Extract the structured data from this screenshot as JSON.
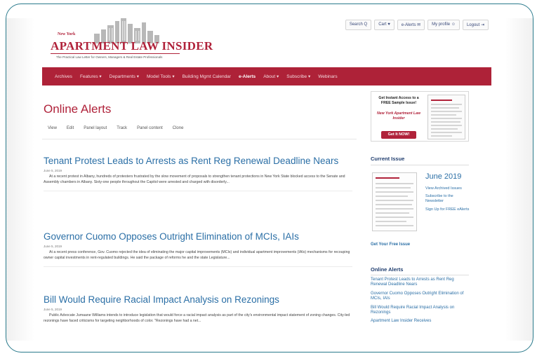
{
  "header": {
    "logo": {
      "newyork": "New York",
      "title": "Apartment Law Insider",
      "tagline": "The Practical Law Letter for Owners, Managers & Real Estate Professionals"
    },
    "toplinks": [
      {
        "label": "Search",
        "icon": "search-icon"
      },
      {
        "label": "Cart",
        "icon": "cart-icon"
      },
      {
        "label": "e-Alerts",
        "icon": "email-icon"
      },
      {
        "label": "My profile",
        "icon": "user-icon"
      },
      {
        "label": "Logout",
        "icon": "logout-icon"
      }
    ],
    "toplink_text": [
      "Search Q",
      "Cart ♥",
      "e-Alerts ✉",
      "My profile ☺",
      "Logout ⇥"
    ]
  },
  "nav": {
    "items": [
      "Archives",
      "Features ▾",
      "Departments ▾",
      "Model Tools ▾",
      "Building Mgmt Calendar",
      "e-Alerts",
      "About ▾",
      "Subscribe ▾",
      "Webinars"
    ],
    "active_index": 5
  },
  "main": {
    "page_title": "Online Alerts",
    "tabs": [
      "View",
      "Edit",
      "Panel layout",
      "Track",
      "Panel content",
      "Clone"
    ],
    "articles": [
      {
        "title": "Tenant Protest Leads to Arrests as Rent Reg Renewal Deadline Nears",
        "date": "June 5, 2019",
        "excerpt": "At a recent protest in Albany, hundreds of protesters frustrated by the slow movement of proposals to strengthen tenant protections in New York State blocked access to the Senate and Assembly chambers in Albany. Sixty-one people throughout the Capitol were arrested and charged with disorderly..."
      },
      {
        "title": "Governor Cuomo Opposes Outright Elimination of MCIs, IAIs",
        "date": "June 5, 2019",
        "excerpt": "At a recent press conference, Gov. Cuomo rejected the idea of eliminating the major capital improvements (MCIs) and individual apartment improvements (IAIs) mechanisms for recouping owner capital investments in rent-regulated buildings. He said the package of reforms he and the state Legislature..."
      },
      {
        "title": "Bill Would Require Racial Impact Analysis on Rezonings",
        "date": "June 5, 2019",
        "excerpt": "Public Advocate Jumaane Williams intends to introduce legislation that would force a racial impact analysis as part of the city's environmental impact statement of zoning changes. City-led rezonings have faced criticisms for targeting neighborhoods of color. \"Rezonings have had a net..."
      }
    ]
  },
  "sidebar": {
    "promo": {
      "headline": "Get Instant Access to a FREE Sample Issue!",
      "subline": "New York Apartment Law Insider",
      "button": "Get It NOW!"
    },
    "current_issue": {
      "heading": "Current Issue",
      "date": "June 2019",
      "links": [
        "View Archived Issues",
        "Subscribe to the Newsletter",
        "Sign Up for FREE eAlerts"
      ],
      "free_issue": "Get Your Free Issue"
    },
    "online_alerts": {
      "heading": "Online Alerts",
      "links": [
        "Tenant Protest Leads to Arrests as Rent Reg Renewal Deadline Nears",
        "Governor Cuomo Opposes Outright Elimination of MCIs, IAIs",
        "Bill Would Require Racial Impact Analysis on Rezonings",
        "Apartment Law Insider Receives"
      ]
    }
  },
  "colors": {
    "brand_red": "#ae2238",
    "link_blue": "#2b6fa6",
    "frame_teal": "#2a7a8c"
  }
}
